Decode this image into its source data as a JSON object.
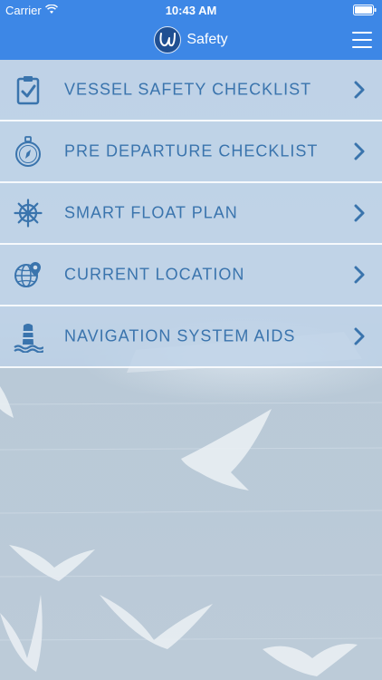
{
  "status_bar": {
    "carrier": "Carrier",
    "time": "10:43 AM"
  },
  "nav": {
    "title": "Safety",
    "logo_letter": "U"
  },
  "menu": [
    {
      "label": "VESSEL SAFETY CHECKLIST",
      "icon": "clipboard-check-icon"
    },
    {
      "label": "PRE DEPARTURE CHECKLIST",
      "icon": "compass-icon"
    },
    {
      "label": "SMART FLOAT PLAN",
      "icon": "ship-wheel-icon"
    },
    {
      "label": "CURRENT LOCATION",
      "icon": "globe-pin-icon"
    },
    {
      "label": "NAVIGATION SYSTEM AIDS",
      "icon": "buoy-icon"
    }
  ],
  "colors": {
    "header": "#3d87e6",
    "menu_text": "#3a74ad",
    "icon": "#3a74ad"
  }
}
